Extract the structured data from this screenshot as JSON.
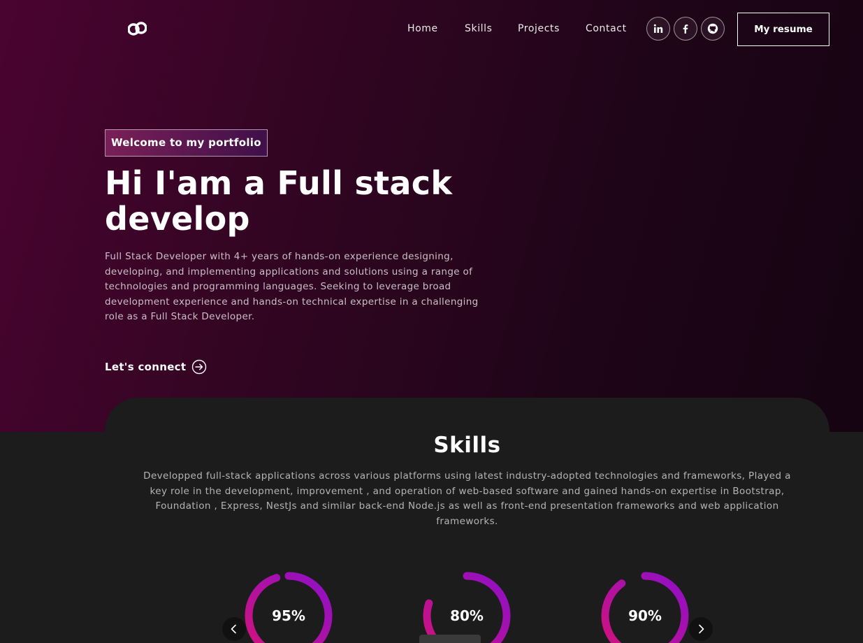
{
  "nav": {
    "links": [
      "Home",
      "Skills",
      "Projects",
      "Contact"
    ],
    "social_icons": [
      "linkedin-icon",
      "facebook-icon",
      "github-icon"
    ],
    "resume_label": "My resume"
  },
  "hero": {
    "tagline": "Welcome to my portfolio",
    "title_line1": "Hi I'am a Full stack",
    "title_line2": "develop",
    "description": "Full Stack Developer with 4+ years of hands-on experience designing, developing, and implementing applications and solutions using a range of technologies and programming languages. Seeking to leverage broad development experience and hands-on technical expertise in a challenging role as a Full Stack Developer.",
    "connect_label": "Let's connect"
  },
  "skills": {
    "title": "Skills",
    "description": "Developped full-stack applications across various platforms using latest industry-adopted technologies and frameworks, Played a key role in the development, improvement , and operation of web-based software and gained hands-on expertise in Bootstrap, Foundation , Express, NestJs and similar back-end Node.js as well as front-end presentation frameworks and web application frameworks.",
    "items": [
      {
        "label": "95%",
        "progress": 0.95
      },
      {
        "label": "80%",
        "progress": 0.8
      },
      {
        "label": "90%",
        "progress": 0.9
      }
    ]
  },
  "colors": {
    "hero_gradient_start": "#4a0430",
    "hero_gradient_end": "#150412",
    "ring_start": "#d2127a",
    "ring_end": "#8e10c8",
    "card_bg": "#1c1c1c"
  }
}
